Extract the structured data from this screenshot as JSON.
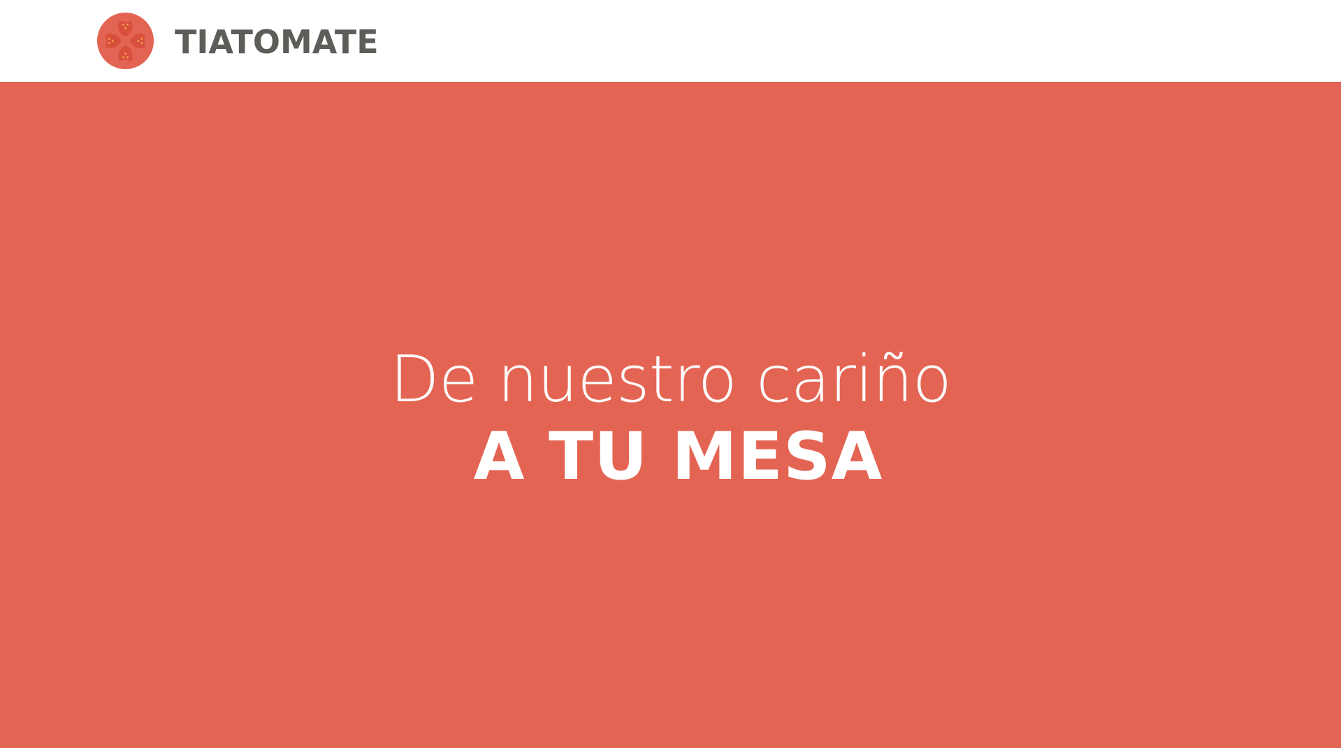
{
  "header": {
    "brand_name": "TIATOMATE",
    "logo_icon": "tomato-slice-icon"
  },
  "hero": {
    "line1": "De nuestro cariño",
    "line2": "A TU MESA"
  },
  "colors": {
    "hero_background": "#e46453",
    "header_background": "#ffffff",
    "brand_text": "#5c5e59",
    "hero_text": "#ffffff",
    "tomato_accent": "#f3a24a"
  }
}
